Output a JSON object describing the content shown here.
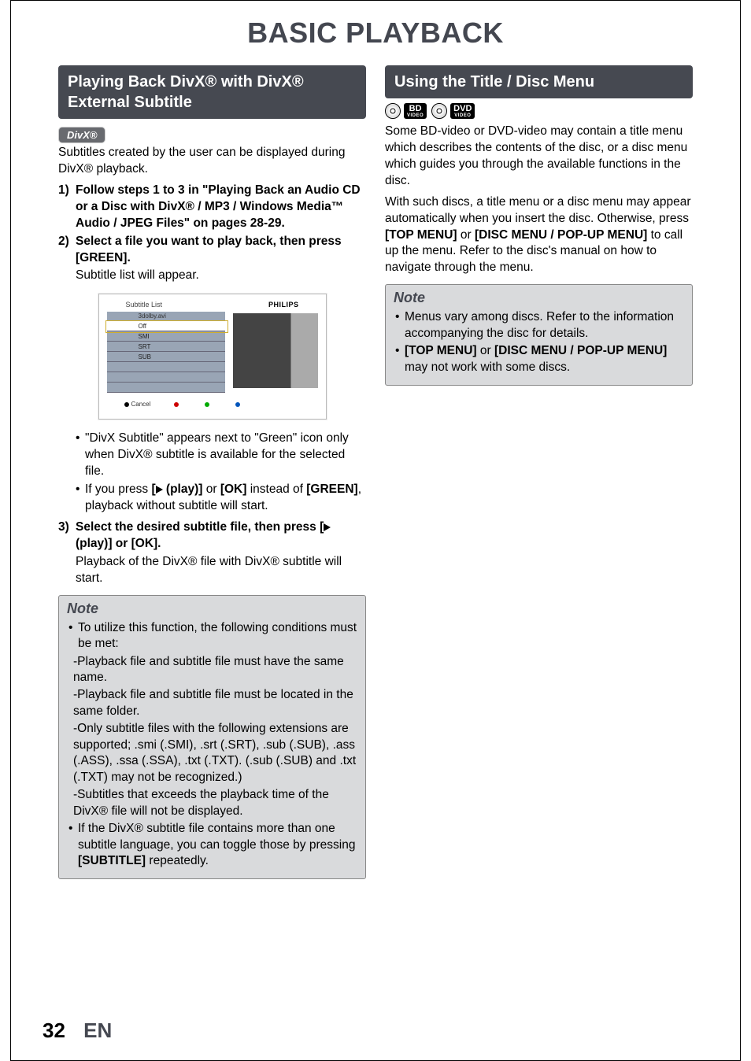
{
  "page": {
    "title": "BASIC PLAYBACK",
    "number": "32",
    "lang": "EN"
  },
  "left": {
    "section_title": "Playing Back DivX® with DivX® External Subtitle",
    "divx_badge": "DivX®",
    "intro": "Subtitles created by the user can be displayed during DivX® playback.",
    "steps": [
      {
        "num": "1)",
        "bold": "Follow steps 1 to 3 in \"Playing Back an Audio CD or a Disc with DivX® / MP3 / Windows Media™ Audio / JPEG Files\" on pages 28-29."
      },
      {
        "num": "2)",
        "bold": "Select a file you want to play back, then press [GREEN].",
        "sub": "Subtitle list will appear."
      }
    ],
    "mock": {
      "title": "Subtitle List",
      "brand": "PHILIPS",
      "file": "3dolby.avi",
      "options": [
        "Off",
        "SMI",
        "SRT",
        "SUB"
      ],
      "footer_cancel": "Cancel"
    },
    "after_mock_bullets": [
      "\"DivX Subtitle\" appears next to \"Green\" icon only when DivX® subtitle is available for the selected file.",
      "If you press [▶ (play)] or [OK] instead of [GREEN], playback without subtitle will start."
    ],
    "step3": {
      "num": "3)",
      "bold": "Select the desired subtitle file, then press [▶ (play)] or [OK].",
      "sub": "Playback of the DivX® file with DivX® subtitle will start."
    },
    "note": {
      "title": "Note",
      "items": [
        "To utilize this function, the following conditions must be met:",
        "-Playback file and subtitle file must have the same name.",
        "-Playback file and subtitle file must be located in the same folder.",
        "-Only subtitle files with the following extensions are supported; .smi (.SMI), .srt (.SRT), .sub (.SUB), .ass (.ASS), .ssa (.SSA), .txt (.TXT). (.sub (.SUB) and .txt (.TXT) may not be recognized.)",
        "-Subtitles that exceeds the playback time of the DivX® file will not be displayed.",
        "If the DivX® subtitle file contains more than one subtitle language, you can toggle those by pressing [SUBTITLE] repeatedly."
      ]
    }
  },
  "right": {
    "section_title": "Using the Title / Disc Menu",
    "badges": {
      "bd": "BD",
      "dvd": "DVD",
      "sub": "VIDEO"
    },
    "para1": "Some BD-video or DVD-video may contain a title menu which describes the contents of the disc, or a disc menu which guides you through the available functions in the disc.",
    "para2_pre": "With such discs, a title menu or a disc menu may appear automatically when you insert the disc. Otherwise, press ",
    "para2_b1": "[TOP MENU]",
    "para2_mid": " or ",
    "para2_b2": "[DISC MENU / POP-UP MENU]",
    "para2_post": " to call up the menu. Refer to the disc's manual on how to navigate through the menu.",
    "note": {
      "title": "Note",
      "item1": "Menus vary among discs. Refer to the information accompanying the disc for details.",
      "item2_b1": "[TOP MENU]",
      "item2_mid": " or ",
      "item2_b2": "[DISC MENU / POP-UP MENU]",
      "item2_post": " may not work with some discs."
    }
  }
}
